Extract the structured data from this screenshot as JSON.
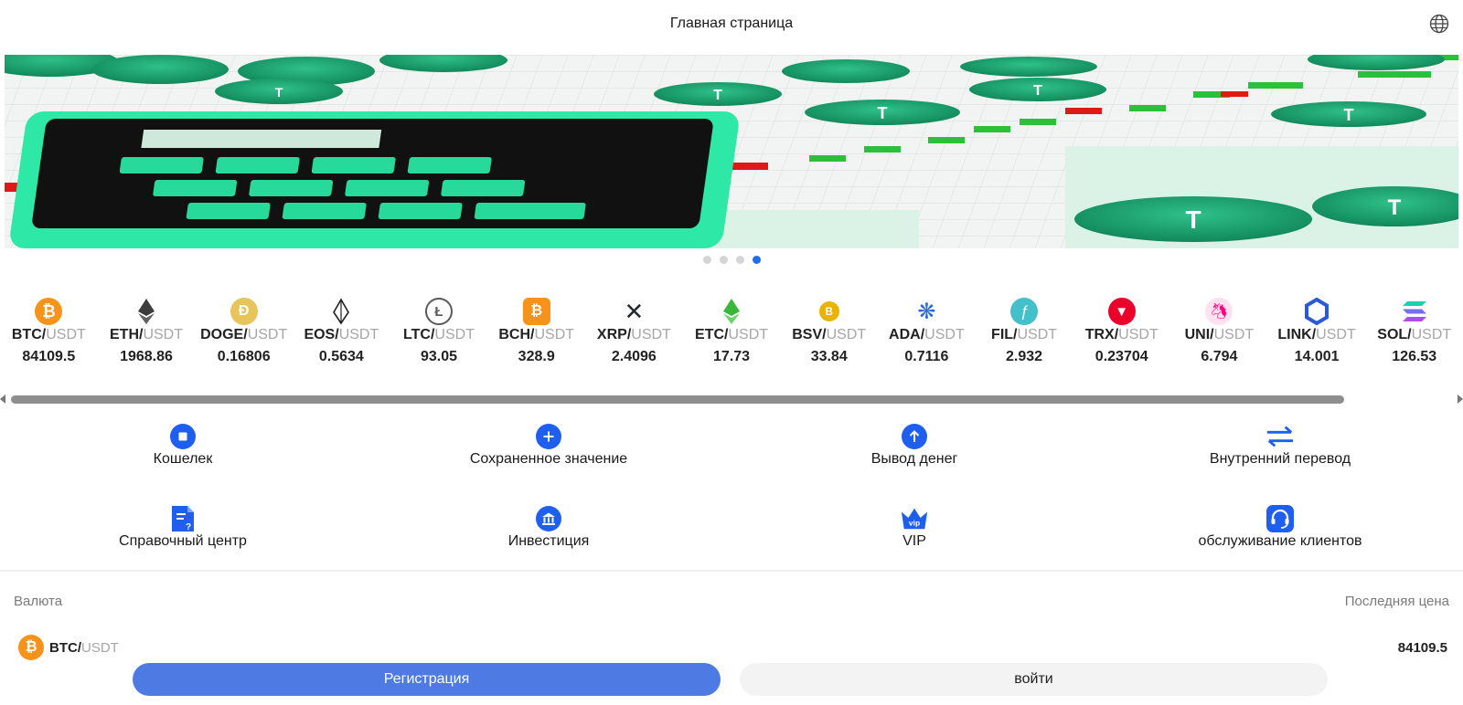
{
  "header": {
    "title": "Главная страница",
    "language_icon": "globe-icon"
  },
  "banner": {
    "slides": 4,
    "active_slide": 4
  },
  "ticker": [
    {
      "base": "BTC",
      "quote": "USDT",
      "price": "84109.5",
      "icon": "bitcoin-icon",
      "color": "#f7931a"
    },
    {
      "base": "ETH",
      "quote": "USDT",
      "price": "1968.86",
      "icon": "ethereum-icon",
      "color": "#3c3c3d"
    },
    {
      "base": "DOGE",
      "quote": "USDT",
      "price": "0.16806",
      "icon": "dogecoin-icon",
      "color": "#c2a633"
    },
    {
      "base": "EOS",
      "quote": "USDT",
      "price": "0.5634",
      "icon": "eos-icon",
      "color": "#222222"
    },
    {
      "base": "LTC",
      "quote": "USDT",
      "price": "93.05",
      "icon": "litecoin-icon",
      "color": "#5a5a5a"
    },
    {
      "base": "BCH",
      "quote": "USDT",
      "price": "328.9",
      "icon": "bitcoin-cash-icon",
      "color": "#f7931a"
    },
    {
      "base": "XRP",
      "quote": "USDT",
      "price": "2.4096",
      "icon": "xrp-icon",
      "color": "#23292f"
    },
    {
      "base": "ETC",
      "quote": "USDT",
      "price": "17.73",
      "icon": "ethereum-classic-icon",
      "color": "#3ab83a"
    },
    {
      "base": "BSV",
      "quote": "USDT",
      "price": "33.84",
      "icon": "bitcoin-sv-icon",
      "color": "#eab300"
    },
    {
      "base": "ADA",
      "quote": "USDT",
      "price": "0.7116",
      "icon": "cardano-icon",
      "color": "#0033ad"
    },
    {
      "base": "FIL",
      "quote": "USDT",
      "price": "2.932",
      "icon": "filecoin-icon",
      "color": "#42c1ca"
    },
    {
      "base": "TRX",
      "quote": "USDT",
      "price": "0.23704",
      "icon": "tron-icon",
      "color": "#eb0029"
    },
    {
      "base": "UNI",
      "quote": "USDT",
      "price": "6.794",
      "icon": "uniswap-icon",
      "color": "#ff007a"
    },
    {
      "base": "LINK",
      "quote": "USDT",
      "price": "14.001",
      "icon": "chainlink-icon",
      "color": "#2a5ada"
    },
    {
      "base": "SOL",
      "quote": "USDT",
      "price": "126.53",
      "icon": "solana-icon",
      "color": "#9945ff"
    }
  ],
  "actions": [
    {
      "label": "Кошелек",
      "icon": "wallet-icon"
    },
    {
      "label": "Сохраненное значение",
      "icon": "plus-icon"
    },
    {
      "label": "Вывод денег",
      "icon": "arrow-up-icon"
    },
    {
      "label": "Внутренний перевод",
      "icon": "transfer-icon"
    },
    {
      "label": "Справочный центр",
      "icon": "help-document-icon"
    },
    {
      "label": "Инвестиция",
      "icon": "bank-icon"
    },
    {
      "label": "VIP",
      "icon": "vip-crown-icon"
    },
    {
      "label": "обслуживание клиентов",
      "icon": "headset-icon"
    }
  ],
  "market": {
    "col_currency": "Валюта",
    "col_last_price": "Последняя цена",
    "rows": [
      {
        "base": "BTC",
        "quote": "USDT",
        "price": "84109.5",
        "icon": "bitcoin-icon"
      }
    ]
  },
  "bottom": {
    "register": "Регистрация",
    "login": "войти"
  },
  "colors": {
    "accent": "#1f5ff0",
    "register_button": "#4d7be3",
    "active_dot": "#1f6df0"
  }
}
